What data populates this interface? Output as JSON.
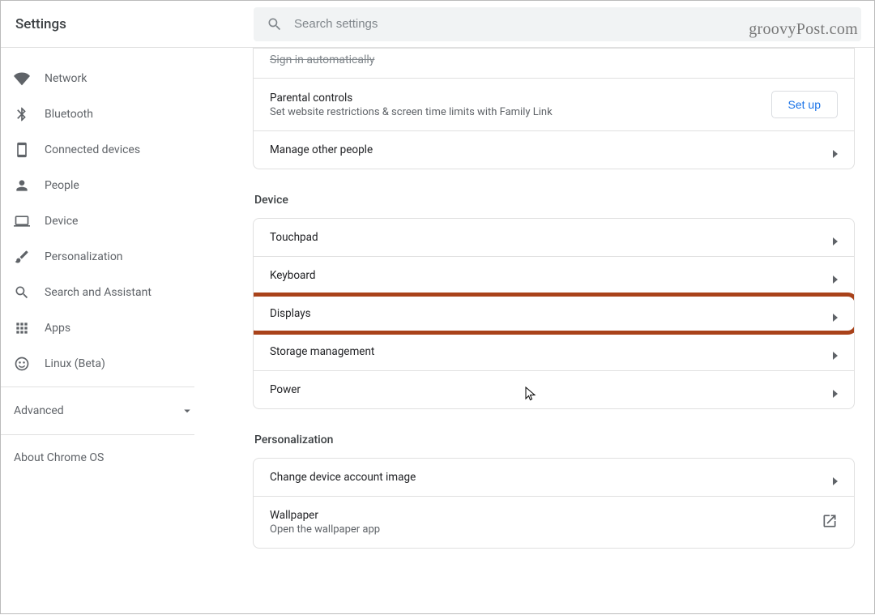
{
  "header": {
    "title": "Settings",
    "search_placeholder": "Search settings"
  },
  "watermark": "groovyPost.com",
  "sidebar": {
    "items": [
      {
        "label": "Network"
      },
      {
        "label": "Bluetooth"
      },
      {
        "label": "Connected devices"
      },
      {
        "label": "People"
      },
      {
        "label": "Device"
      },
      {
        "label": "Personalization"
      },
      {
        "label": "Search and Assistant"
      },
      {
        "label": "Apps"
      },
      {
        "label": "Linux (Beta)"
      }
    ],
    "advanced": "Advanced",
    "about": "About Chrome OS"
  },
  "main": {
    "truncated_row": "Sign in automatically",
    "people_card": {
      "parental": {
        "title": "Parental controls",
        "sub": "Set website restrictions & screen time limits with Family Link",
        "button": "Set up"
      },
      "manage": "Manage other people"
    },
    "device_section": {
      "title": "Device",
      "rows": [
        {
          "label": "Touchpad"
        },
        {
          "label": "Keyboard"
        },
        {
          "label": "Displays",
          "highlight": true
        },
        {
          "label": "Storage management"
        },
        {
          "label": "Power"
        }
      ]
    },
    "personalization_section": {
      "title": "Personalization",
      "rows": [
        {
          "label": "Change device account image"
        },
        {
          "label": "Wallpaper",
          "sub": "Open the wallpaper app",
          "external": true
        }
      ]
    }
  }
}
